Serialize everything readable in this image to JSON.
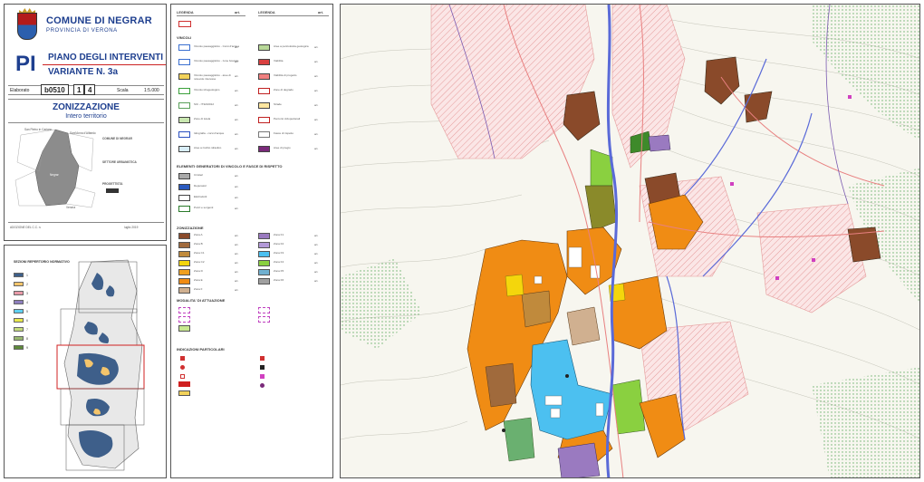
{
  "header": {
    "municipality": "COMUNE DI NEGRAR",
    "province": "PROVINCIA DI VERONA",
    "plan_abbrev": "PI",
    "plan_title": "PIANO DEGLI INTERVENTI",
    "variant": "VARIANTE N. 3a",
    "field_label": "Elaborato",
    "elaborato_code": "b0510",
    "sheet_1": "1",
    "sheet_2": "4",
    "scale_label": "Scala",
    "scale": "1:5.000",
    "map_title": "ZONIZZAZIONE",
    "map_subtitle": "Intero territorio"
  },
  "title_block": {
    "mini_label_1": "San Pietro in Cariano",
    "mini_label_2": "Sant'Anna d'Alfaedo",
    "mini_label_3": "Verona",
    "mini_label_4": "Negrar",
    "side_label_1": "COMUNE DI NEGRAR",
    "side_label_2": "SETTORE URBANISTICA",
    "side_label_3": "PROGETTISTA",
    "footer_left": "ADOZIONE DEL C.C. n.",
    "footer_right": "luglio 2019"
  },
  "overview": {
    "title": "SEZIONI REPERTORIO NORMATIVO",
    "keys": [
      {
        "num": "1",
        "color": "#3e5f8a"
      },
      {
        "num": "2",
        "color": "#f4c56c"
      },
      {
        "num": "3",
        "color": "#e89aa8"
      },
      {
        "num": "4",
        "color": "#8e7fbf"
      },
      {
        "num": "5",
        "color": "#5fd0f2"
      },
      {
        "num": "6",
        "color": "#e8e84c"
      },
      {
        "num": "7",
        "color": "#c4dc7c"
      },
      {
        "num": "8",
        "color": "#98b870"
      },
      {
        "num": "9",
        "color": "#5e8a3c"
      }
    ]
  },
  "legend": {
    "col_headers": [
      "LEGENDA",
      "art.",
      "LEGENDA",
      "art."
    ],
    "sec_vincoli": "VINCOLI",
    "sec_elementi": "ELEMENTI GENERATORI DI VINCOLO E FASCE DI RISPETTO",
    "sec_zonizzazione": "ZONIZZAZIONE",
    "sec_modalita": "MODALITA' DI ATTUAZIONE",
    "sec_indicazioni": "INDICAZIONI PARTICOLARI",
    "vincoli": [
      {
        "label": "Vincolo paesaggistico - Corsi d'acqua",
        "ref": "art.",
        "fill": "#ffffff",
        "border": "#3a6fd0"
      },
      {
        "label": "Vincolo paesaggistico - zone boscate",
        "ref": "art.",
        "fill": "#ffffff",
        "border": "#3a6fd0"
      },
      {
        "label": "Vincolo paesaggistico - aree di notevole interesse",
        "ref": "art.",
        "fill": "#f2d25a",
        "border": "#444"
      },
      {
        "label": "Vincolo idrogeologico",
        "ref": "art.",
        "fill": "#ffffff",
        "border": "#3aa03a"
      },
      {
        "label": "SIC - IT3210012",
        "ref": "art.",
        "fill": "#ffffff",
        "border": "#5aa05a"
      },
      {
        "label": "Zone di tutela",
        "ref": "art.",
        "fill": "#c9e7b0",
        "border": "#444"
      },
      {
        "label": "Idrografia - corsi d'acqua",
        "ref": "art.",
        "fill": "#ffffff",
        "border": "#2a50c0"
      },
      {
        "label": "Aree a rischio idraulico",
        "ref": "art.",
        "fill": "#d8eef8",
        "border": "#444"
      }
    ],
    "vincoli_right": [
      {
        "label": "Aree a pericolosita geologica",
        "ref": "art.",
        "fill": "#b8d898",
        "border": "#444"
      },
      {
        "label": "Viabilita",
        "ref": "art.",
        "fill": "#d94040",
        "border": "#444"
      },
      {
        "label": "Viabilita di progetto",
        "ref": "art.",
        "fill": "#f08080",
        "border": "#444"
      },
      {
        "label": "Zone di degrado",
        "ref": "art.",
        "fill": "#ffffff",
        "border": "#c02020"
      },
      {
        "label": "Strade",
        "ref": "art.",
        "fill": "#ffe7a0",
        "border": "#444"
      },
      {
        "label": "Percorsi ciclopedonali",
        "ref": "art.",
        "fill": "#ffffff",
        "border": "#c02020"
      },
      {
        "label": "Fasce di rispetto",
        "ref": "art.",
        "fill": "#ffffff",
        "border": "#777"
      },
      {
        "label": "Aree di pregio",
        "ref": "art.",
        "fill": "#7a2a7a",
        "border": "#444"
      }
    ],
    "elementi": [
      {
        "label": "Cimiteri",
        "ref": "art.",
        "fill": "#aaaaaa",
        "border": "#444"
      },
      {
        "label": "Depuratori",
        "ref": "art.",
        "fill": "#2a5ac0",
        "border": "#444"
      },
      {
        "label": "Elettrodotti",
        "ref": "art.",
        "fill": "#ffffff",
        "border": "#444"
      },
      {
        "label": "Pozzi e sorgenti",
        "ref": "art.",
        "fill": "#ffffff",
        "border": "#2a7a2a"
      }
    ],
    "zone_left": [
      {
        "label": "Zona A",
        "ref": "art.",
        "fill": "#8a4a2a"
      },
      {
        "label": "Zona B",
        "ref": "art.",
        "fill": "#a06a3c"
      },
      {
        "label": "Zona C1",
        "ref": "art.",
        "fill": "#c08a3c"
      },
      {
        "label": "Zona C2",
        "ref": "art.",
        "fill": "#f4d60c"
      },
      {
        "label": "Zona D",
        "ref": "art.",
        "fill": "#f0a020"
      },
      {
        "label": "Zona E",
        "ref": "art.",
        "fill": "#f08c14"
      },
      {
        "label": "Zona F",
        "ref": "art.",
        "fill": "#d0b090"
      }
    ],
    "zone_right": [
      {
        "label": "Zona F1",
        "ref": "art.",
        "fill": "#9a7ac0"
      },
      {
        "label": "Zona F2",
        "ref": "art.",
        "fill": "#b39ad8"
      },
      {
        "label": "Zona F3",
        "ref": "art.",
        "fill": "#4cc0f0"
      },
      {
        "label": "Zona F4",
        "ref": "art.",
        "fill": "#8ad040"
      },
      {
        "label": "Zona F5",
        "ref": "art.",
        "fill": "#70b0d0"
      },
      {
        "label": "Zona F6",
        "ref": "art.",
        "fill": "#a0a0a0"
      }
    ]
  },
  "map": {
    "river_color": "#5a6ad8",
    "contour_color": "#b9b9b0",
    "hatch_color": "#e8a8a8"
  }
}
